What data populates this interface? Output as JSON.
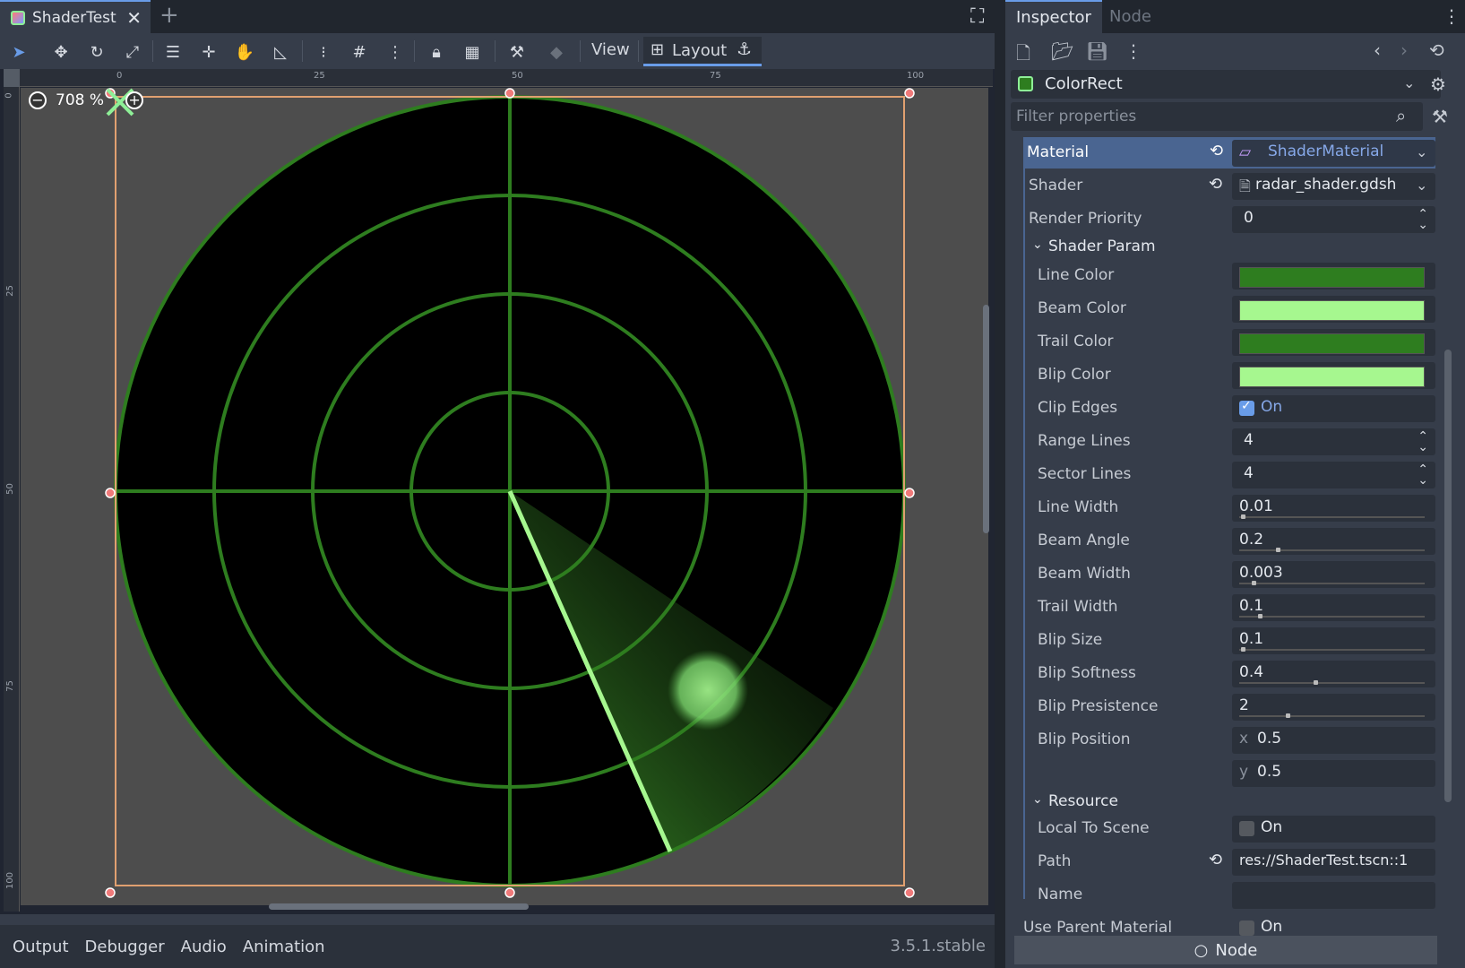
{
  "editor": {
    "tab_title": "ShaderTest",
    "tool_view": "View",
    "tool_layout": "Layout",
    "zoom": "708 %",
    "ruler_h": [
      "0",
      "25",
      "50",
      "75",
      "100"
    ],
    "ruler_v": [
      "0",
      "25",
      "50",
      "75",
      "100"
    ]
  },
  "bottom": {
    "tabs": [
      "Output",
      "Debugger",
      "Audio",
      "Animation"
    ],
    "version": "3.5.1.stable"
  },
  "inspector": {
    "tabs": [
      "Inspector",
      "Node"
    ],
    "object": "ColorRect",
    "filter_placeholder": "Filter properties",
    "material_label": "Material",
    "material_value": "ShaderMaterial",
    "shader_label": "Shader",
    "shader_value": "radar_shader.gdsh",
    "render_priority_label": "Render Priority",
    "render_priority_value": "0",
    "section_shader_param": "Shader Param",
    "colors": [
      {
        "label": "Line Color",
        "color": "#2e7d1f"
      },
      {
        "label": "Beam Color",
        "color": "#a6f78f"
      },
      {
        "label": "Trail Color",
        "color": "#2e7d1f"
      },
      {
        "label": "Blip Color",
        "color": "#a6f78f"
      }
    ],
    "clip_edges_label": "Clip Edges",
    "clip_edges_value": "On",
    "range_lines_label": "Range Lines",
    "range_lines_value": "4",
    "sector_lines_label": "Sector Lines",
    "sector_lines_value": "4",
    "sliders": [
      {
        "label": "Line Width",
        "value": "0.01",
        "fraction": 0.01
      },
      {
        "label": "Beam Angle",
        "value": "0.2",
        "fraction": 0.2
      },
      {
        "label": "Beam Width",
        "value": "0.003",
        "fraction": 0.07
      },
      {
        "label": "Trail Width",
        "value": "0.1",
        "fraction": 0.1
      },
      {
        "label": "Blip Size",
        "value": "0.1",
        "fraction": 0.01
      },
      {
        "label": "Blip Softness",
        "value": "0.4",
        "fraction": 0.4
      },
      {
        "label": "Blip Presistence",
        "value": "2",
        "fraction": 0.25
      }
    ],
    "blip_position_label": "Blip Position",
    "blip_x_axis": "x",
    "blip_x": "0.5",
    "blip_y_axis": "y",
    "blip_y": "0.5",
    "section_resource": "Resource",
    "local_to_scene_label": "Local To Scene",
    "local_to_scene_value": "On",
    "path_label": "Path",
    "path_value": "res://ShaderTest.tscn::1",
    "name_label": "Name",
    "use_parent_label": "Use Parent Material",
    "use_parent_value": "On",
    "footer": "Node"
  }
}
